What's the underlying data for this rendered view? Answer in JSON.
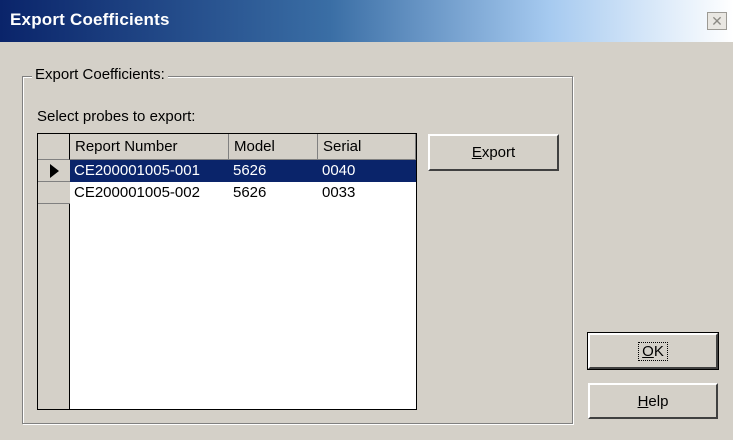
{
  "window": {
    "title": "Export Coefficients",
    "close_glyph": "✕"
  },
  "group": {
    "label": "Export Coefficients:",
    "select_label": "Select probes to export:"
  },
  "grid": {
    "columns": [
      "Report Number",
      "Model",
      "Serial"
    ],
    "rows": [
      {
        "report": "CE200001005-001",
        "model": "5626",
        "serial": "0040",
        "selected": true
      },
      {
        "report": "CE200001005-002",
        "model": "5626",
        "serial": "0033",
        "selected": false
      }
    ]
  },
  "buttons": {
    "export": {
      "mnemonic": "E",
      "rest": "xport"
    },
    "ok": {
      "mnemonic": "O",
      "rest": "K"
    },
    "help": {
      "mnemonic": "H",
      "rest": "elp"
    }
  },
  "colors": {
    "selection": "#0a246a",
    "face": "#d4d0c8"
  }
}
